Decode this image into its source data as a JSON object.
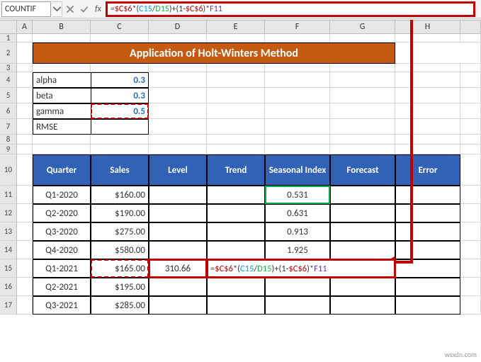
{
  "name_box": "COUNTIF",
  "formula": "=$C$6*(C15/D15)+(1-$C$6)*F11",
  "col_labels": [
    "A",
    "B",
    "C",
    "D",
    "E",
    "F",
    "G",
    "H"
  ],
  "title": "Application of Holt-Winters Method",
  "params": [
    {
      "label": "alpha",
      "value": "0.3"
    },
    {
      "label": "beta",
      "value": "0.3"
    },
    {
      "label": "gamma",
      "value": "0.5"
    },
    {
      "label": "RMSE",
      "value": ""
    }
  ],
  "headers": {
    "quarter": "Quarter",
    "sales": "Sales",
    "level": "Level",
    "trend": "Trend",
    "seasonal": "Seasonal Index",
    "forecast": "Forecast",
    "error": "Error"
  },
  "data_rows": [
    {
      "q": "Q1-2020",
      "sales": "$160.00",
      "level": "",
      "trend": "",
      "si": "0.531",
      "fc": "",
      "err": ""
    },
    {
      "q": "Q2-2020",
      "sales": "$190.00",
      "level": "",
      "trend": "",
      "si": "0.631",
      "fc": "",
      "err": ""
    },
    {
      "q": "Q3-2020",
      "sales": "$275.00",
      "level": "",
      "trend": "",
      "si": "0.913",
      "fc": "",
      "err": ""
    },
    {
      "q": "Q4-2020",
      "sales": "$580.00",
      "level": "",
      "trend": "",
      "si": "1.925",
      "fc": "",
      "err": ""
    },
    {
      "q": "Q1-2021",
      "sales": "$165.00",
      "level": "310.66",
      "trend": "=$C$6*(C15/D15)+(1-$C$6)*F11",
      "si": "",
      "fc": "",
      "err": ""
    },
    {
      "q": "Q2-2021",
      "sales": "$195.00",
      "level": "",
      "trend": "",
      "si": "",
      "fc": "",
      "err": ""
    },
    {
      "q": "Q3-2021",
      "sales": "$285.00",
      "level": "",
      "trend": "",
      "si": "",
      "fc": "",
      "err": ""
    }
  ],
  "chart_data": {
    "type": "table",
    "title": "Application of Holt-Winters Method",
    "parameters": {
      "alpha": 0.3,
      "beta": 0.3,
      "gamma": 0.5,
      "RMSE": null
    },
    "columns": [
      "Quarter",
      "Sales",
      "Level",
      "Trend",
      "Seasonal Index",
      "Forecast",
      "Error"
    ],
    "rows": [
      [
        "Q1-2020",
        160.0,
        null,
        null,
        0.531,
        null,
        null
      ],
      [
        "Q2-2020",
        190.0,
        null,
        null,
        0.631,
        null,
        null
      ],
      [
        "Q3-2020",
        275.0,
        null,
        null,
        0.913,
        null,
        null
      ],
      [
        "Q4-2020",
        580.0,
        null,
        null,
        1.925,
        null,
        null
      ],
      [
        "Q1-2021",
        165.0,
        310.66,
        "=$C$6*(C15/D15)+(1-$C$6)*F11",
        null,
        null,
        null
      ],
      [
        "Q2-2021",
        195.0,
        null,
        null,
        null,
        null,
        null
      ],
      [
        "Q3-2021",
        285.0,
        null,
        null,
        null,
        null,
        null
      ]
    ]
  },
  "watermark": "wsxdn.com"
}
